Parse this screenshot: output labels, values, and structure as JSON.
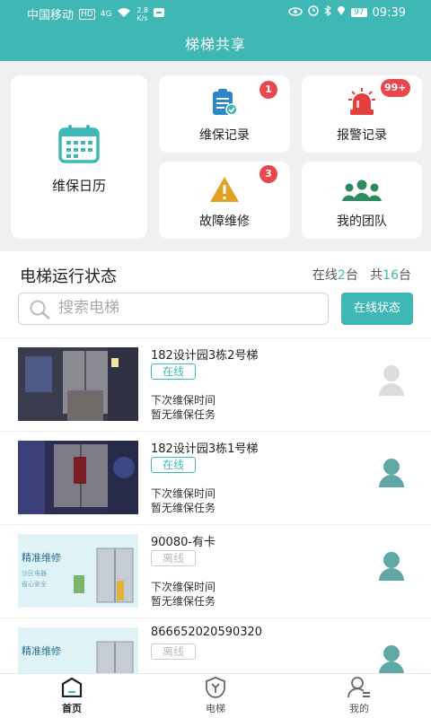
{
  "status_bar": {
    "carrier": "中国移动",
    "hd": "HD",
    "net": "4G",
    "speed_value": "2.8",
    "speed_unit": "K/s",
    "battery": "97",
    "time": "09:39"
  },
  "header": {
    "title": "梯梯共享"
  },
  "shortcuts": {
    "calendar": {
      "label": "维保日历"
    },
    "maintenance": {
      "label": "维保记录",
      "badge": "1"
    },
    "alarm": {
      "label": "报警记录",
      "badge": "99+"
    },
    "fault": {
      "label": "故障维修",
      "badge": "3"
    },
    "team": {
      "label": "我的团队"
    }
  },
  "elevator_status": {
    "title": "电梯运行状态",
    "online_prefix": "在线",
    "online_count": "2",
    "online_suffix": "台",
    "total_prefix": "共",
    "total_count": "16",
    "total_suffix": "台",
    "search_placeholder": "搜索电梯",
    "online_button": "在线状态"
  },
  "elevators": [
    {
      "name": "182设计园3栋2号梯",
      "status": "在线",
      "next_label": "下次维保时间",
      "task": "暂无维保任务"
    },
    {
      "name": "182设计园3栋1号梯",
      "status": "在线",
      "next_label": "下次维保时间",
      "task": "暂无维保任务"
    },
    {
      "name": "90080-有卡",
      "status": "离线",
      "next_label": "下次维保时间",
      "task": "暂无维保任务"
    },
    {
      "name": "866652020590320",
      "status": "离线"
    }
  ],
  "thumb_text": {
    "line1": "精准维修",
    "line2": "沙区电器",
    "line3": "省心安全"
  },
  "tabs": [
    {
      "label": "首页"
    },
    {
      "label": "电梯"
    },
    {
      "label": "我的"
    }
  ],
  "colors": {
    "accent": "#3fb7b4",
    "badge": "#e8474c",
    "warning": "#e2a024",
    "alarm": "#e2403f"
  }
}
